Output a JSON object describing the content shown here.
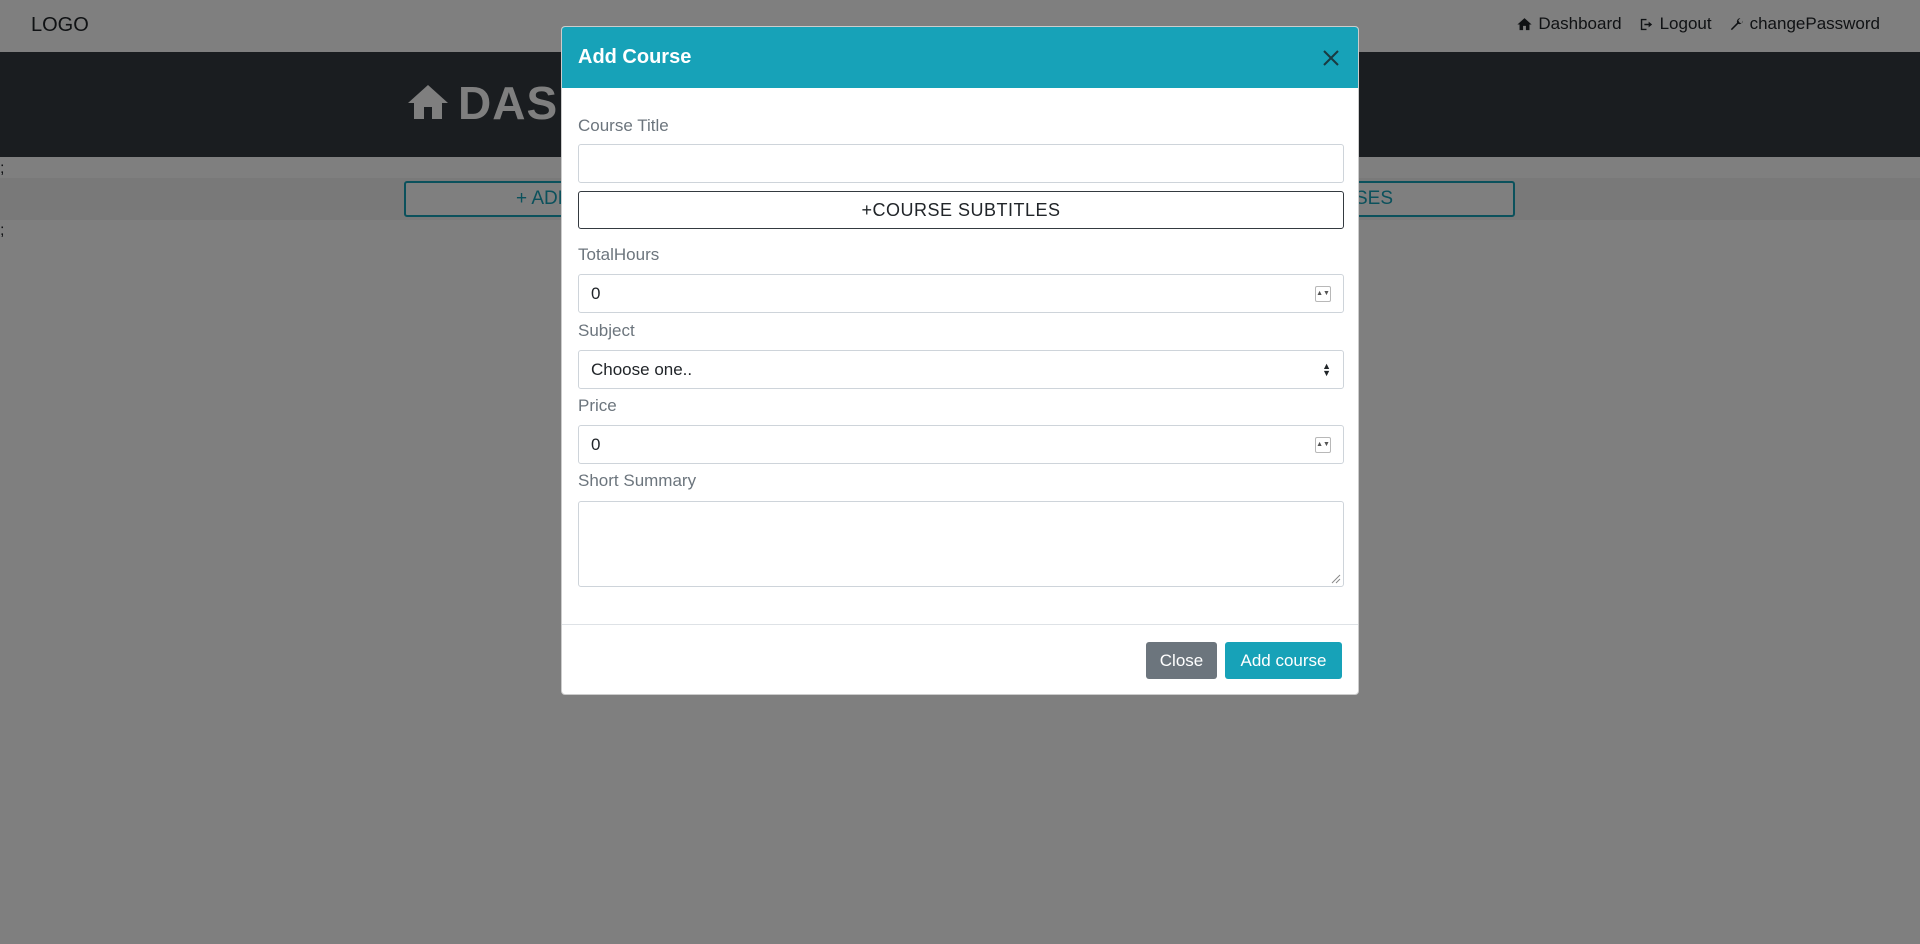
{
  "navbar": {
    "logo": "LOGO",
    "links": [
      {
        "label": "Dashboard",
        "icon": "home-icon"
      },
      {
        "label": "Logout",
        "icon": "logout-icon"
      },
      {
        "label": "changePassword",
        "icon": "wrench-icon"
      }
    ]
  },
  "hero": {
    "title": "DASH"
  },
  "stray_text": [
    ";",
    ";"
  ],
  "page_buttons": {
    "add_label": "+ ADD",
    "view_label": "COURSES"
  },
  "modal": {
    "title": "Add Course",
    "course_title": {
      "label": "Course Title",
      "value": ""
    },
    "subtitles_button": "+COURSE SUBTITLES",
    "total_hours": {
      "label": "TotalHours",
      "value": "0"
    },
    "subject": {
      "label": "Subject",
      "selected": "Choose one.."
    },
    "price": {
      "label": "Price",
      "value": "0"
    },
    "summary": {
      "label": "Short Summary",
      "value": ""
    },
    "footer": {
      "close_label": "Close",
      "submit_label": "Add course"
    }
  },
  "colors": {
    "accent": "#17a2b8",
    "secondary": "#6c757d",
    "hero_bg": "#343a40"
  }
}
